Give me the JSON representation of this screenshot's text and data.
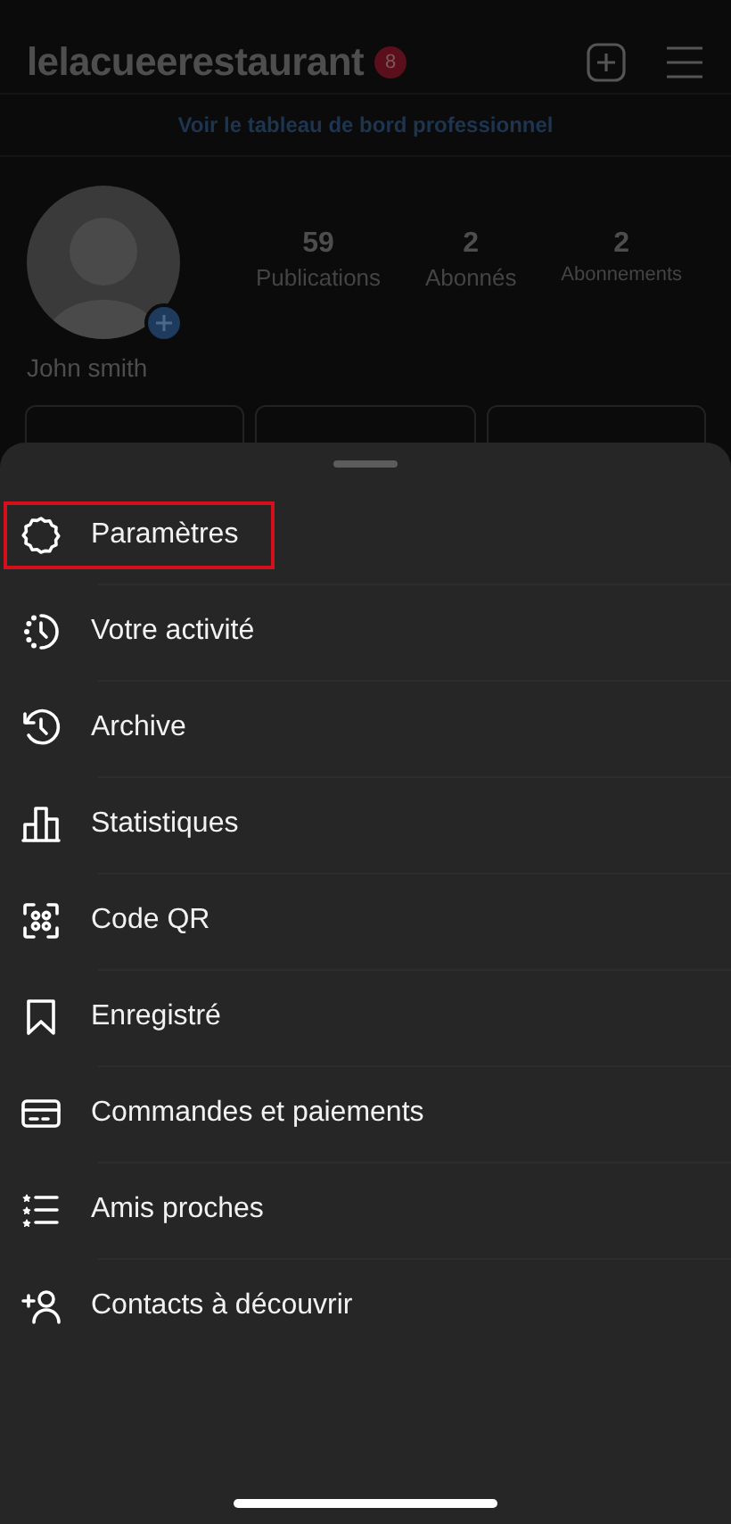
{
  "header": {
    "username": "lelacueerestaurant",
    "notification_count": "8"
  },
  "dashboard_link": "Voir le tableau de bord professionnel",
  "profile": {
    "name": "John smith",
    "stats": [
      {
        "value": "59",
        "label": "Publications"
      },
      {
        "value": "2",
        "label": "Abonnés"
      },
      {
        "value": "2",
        "label": "Abonnements"
      }
    ]
  },
  "menu": {
    "items": [
      {
        "kind": "settings",
        "label": "Paramètres",
        "highlighted": true
      },
      {
        "kind": "activity",
        "label": "Votre activité",
        "highlighted": false
      },
      {
        "kind": "archive",
        "label": "Archive",
        "highlighted": false
      },
      {
        "kind": "stats",
        "label": "Statistiques",
        "highlighted": false
      },
      {
        "kind": "qr",
        "label": "Code QR",
        "highlighted": false
      },
      {
        "kind": "saved",
        "label": "Enregistré",
        "highlighted": false
      },
      {
        "kind": "payments",
        "label": "Commandes et paiements",
        "highlighted": false
      },
      {
        "kind": "close_friends",
        "label": "Amis proches",
        "highlighted": false
      },
      {
        "kind": "discover",
        "label": "Contacts à découvrir",
        "highlighted": false
      }
    ]
  }
}
